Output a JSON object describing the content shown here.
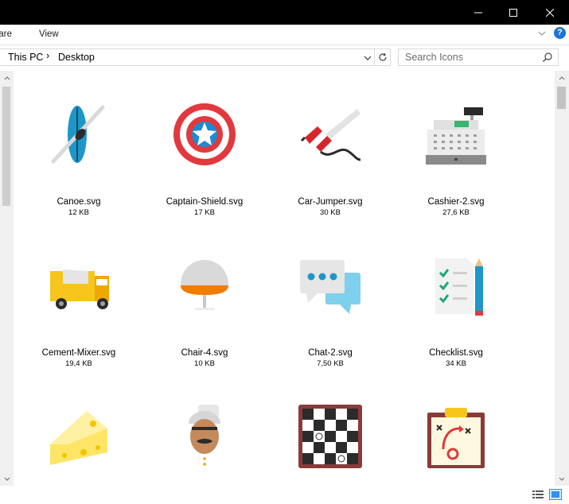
{
  "ribbon": {
    "tab_share": "hare",
    "tab_view": "View",
    "help": "?"
  },
  "address": {
    "crumbs": [
      "This PC",
      "Desktop"
    ],
    "separator": "›"
  },
  "search": {
    "placeholder": "Search Icons"
  },
  "files": [
    {
      "name": "Canoe.svg",
      "size": "12 KB",
      "icon": "canoe-icon"
    },
    {
      "name": "Captain-Shield.svg",
      "size": "17 KB",
      "icon": "captain-shield-icon"
    },
    {
      "name": "Car-Jumper.svg",
      "size": "30 KB",
      "icon": "car-jumper-icon"
    },
    {
      "name": "Cashier-2.svg",
      "size": "27,6 KB",
      "icon": "cash-register-icon"
    },
    {
      "name": "Cement-Mixer.svg",
      "size": "19,4 KB",
      "icon": "cement-mixer-icon"
    },
    {
      "name": "Chair-4.svg",
      "size": "10 KB",
      "icon": "chair-icon"
    },
    {
      "name": "Chat-2.svg",
      "size": "7,50 KB",
      "icon": "chat-icon"
    },
    {
      "name": "Checklist.svg",
      "size": "34 KB",
      "icon": "checklist-icon"
    },
    {
      "name": "",
      "size": "",
      "icon": "cheese-icon"
    },
    {
      "name": "",
      "size": "",
      "icon": "chef-icon"
    },
    {
      "name": "",
      "size": "",
      "icon": "chess-board-icon"
    },
    {
      "name": "",
      "size": "",
      "icon": "clipboard-tactics-icon"
    }
  ],
  "colors": {
    "titlebar": "#000000",
    "accent": "#1a73d9"
  }
}
